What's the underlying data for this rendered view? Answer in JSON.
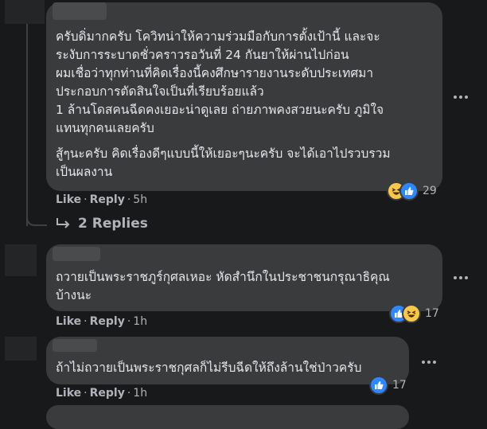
{
  "comments": [
    {
      "lines": [
        "ครับดิ่มากครับ โควิทน่าให้ความร่วมมือกับการตั้งเป้านี้ และจะ",
        "ระงับการระบาดชั่วคราวรอวันที่ 24 กันยาให้ผ่านไปก่อน",
        "ผมเชื่อว่าทุกท่านที่คิดเรื่องนี้คงศึกษารายงานระดับประเทศมา",
        "ประกอบการตัดสินใจเป็นที่เรียบร้อยแล้ว",
        "1 ล้านโดสคนฉีดคงเยอะน่าดูเลย ถ่ายภาพคงสวยนะครับ ภูมิใจ",
        "แทนทุกคนเลยครับ",
        "สู้ๆนะครับ คิดเรื่องดีๆแบบนี้ให้เยอะๆนะครับ จะได้เอาไปรวบรวม",
        "เป็นผลงาน"
      ],
      "like_label": "Like",
      "reply_label": "Reply",
      "time": "5h",
      "reaction_icons": [
        "haha-icon",
        "like-icon"
      ],
      "reaction_count": "29"
    },
    {
      "lines": [
        "ถวายเป็นพระราชภูร์กุศลเหอะ หัดสำนึกในประชาชนกรุณาธิคุณ",
        "บ้างนะ"
      ],
      "like_label": "Like",
      "reply_label": "Reply",
      "time": "1h",
      "reaction_icons": [
        "like-icon",
        "haha-icon"
      ],
      "reaction_count": "17"
    },
    {
      "lines": [
        "ถ้าไม่ถวายเป็นพระราชกุศลก็ไม่รีบฉีดให้ถึงล้านใช่ป่าวครับ"
      ],
      "like_label": "Like",
      "reply_label": "Reply",
      "time": "1h",
      "reaction_icons": [
        "like-icon"
      ],
      "reaction_count": "17"
    }
  ],
  "replies_link": "2 Replies",
  "colors": {
    "background": "#18191a",
    "bubble": "#3a3b3c",
    "text": "#e4e6eb",
    "secondary_text": "#b0b3b8",
    "like_blue": "#2d88ff",
    "haha_yellow": "#f7c84b"
  }
}
